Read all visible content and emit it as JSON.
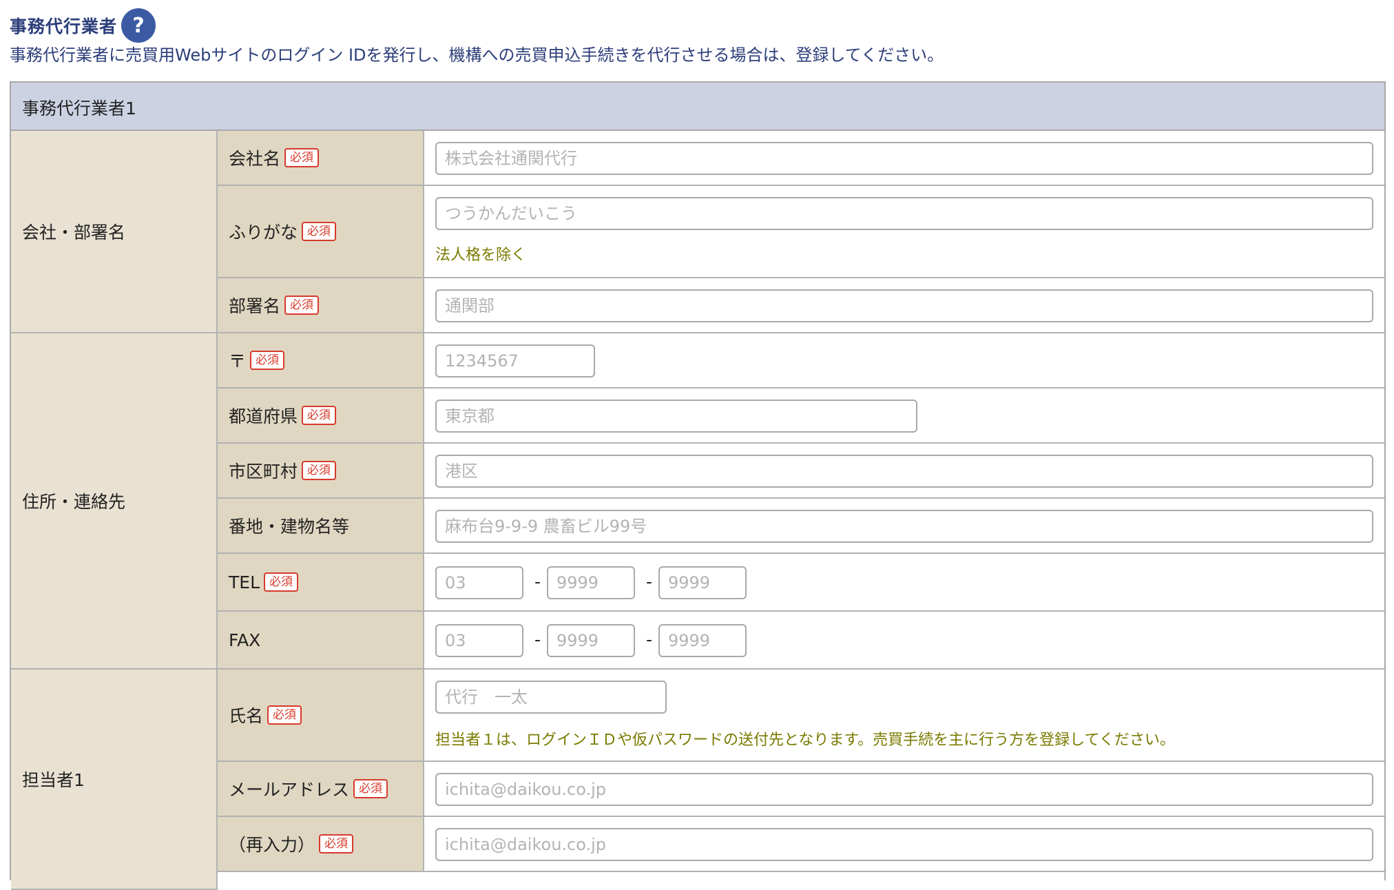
{
  "section": {
    "title": "事務代行業者",
    "help_icon": "?",
    "description": "事務代行業者に売買用Webサイトのログイン IDを発行し、機構への売買申込手続きを代行させる場合は、登録してください。"
  },
  "form": {
    "header": "事務代行業者1",
    "required_badge": "必須",
    "groups": {
      "company": "会社・部署名",
      "address": "住所・連絡先",
      "person": "担当者1"
    },
    "fields": {
      "company_name": {
        "label": "会社名",
        "placeholder": "株式会社通関代行",
        "value": ""
      },
      "furigana": {
        "label": "ふりがな",
        "placeholder": "つうかんだいこう",
        "value": "",
        "note": "法人格を除く"
      },
      "department": {
        "label": "部署名",
        "placeholder": "通関部",
        "value": ""
      },
      "postal": {
        "label": "〒",
        "placeholder": "1234567",
        "value": ""
      },
      "prefecture": {
        "label": "都道府県",
        "placeholder": "東京都",
        "value": ""
      },
      "city": {
        "label": "市区町村",
        "placeholder": "港区",
        "value": ""
      },
      "street": {
        "label": "番地・建物名等",
        "placeholder": "麻布台9-9-9 農畜ビル99号",
        "value": ""
      },
      "tel": {
        "label": "TEL",
        "placeholders": [
          "03",
          "9999",
          "9999"
        ],
        "separator": "-"
      },
      "fax": {
        "label": "FAX",
        "placeholders": [
          "03",
          "9999",
          "9999"
        ],
        "separator": "-"
      },
      "name": {
        "label": "氏名",
        "placeholder": "代行　一太",
        "value": "",
        "note": "担当者１は、ログインＩＤや仮パスワードの送付先となります。売買手続を主に行う方を登録してください。"
      },
      "email": {
        "label": "メールアドレス",
        "placeholder": "ichita@daikou.co.jp",
        "value": ""
      },
      "email_confirm": {
        "label": "（再入力）",
        "placeholder": "ichita@daikou.co.jp",
        "value": ""
      }
    }
  },
  "colors": {
    "accent": "#2c3e7a",
    "help_icon_bg": "#3b5aa3",
    "header_bg": "#cdd2e3",
    "group_bg": "#e9e2d3",
    "label_bg": "#e0d7c2",
    "required": "#d8392b",
    "note": "#7a7a00"
  }
}
